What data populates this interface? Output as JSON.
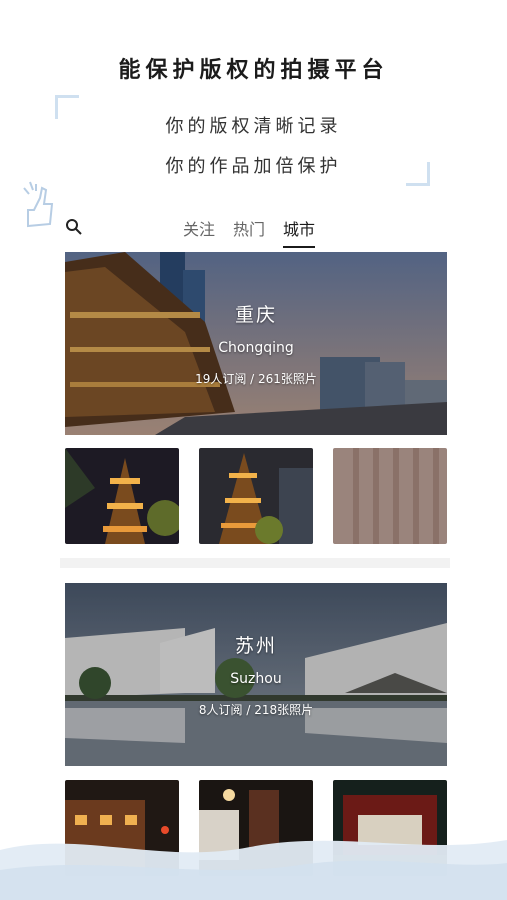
{
  "header": {
    "headline": "能保护版权的拍摄平台",
    "tagline_line1": "你的版权清晰记录",
    "tagline_line2": "你的作品加倍保护"
  },
  "search": {
    "icon": "search-icon"
  },
  "tabs": [
    {
      "label": "关注",
      "active": false
    },
    {
      "label": "热门",
      "active": false
    },
    {
      "label": "城市",
      "active": true
    }
  ],
  "cities": [
    {
      "name_cn": "重庆",
      "name_en": "Chongqing",
      "stats": "19人订阅 / 261张照片"
    },
    {
      "name_cn": "苏州",
      "name_en": "Suzhou",
      "stats": "8人订阅 / 218张照片"
    }
  ],
  "colors": {
    "accent": "#1b1b1b",
    "deco_blue": "#cfe0f0",
    "divider": "#f2f2f2"
  }
}
